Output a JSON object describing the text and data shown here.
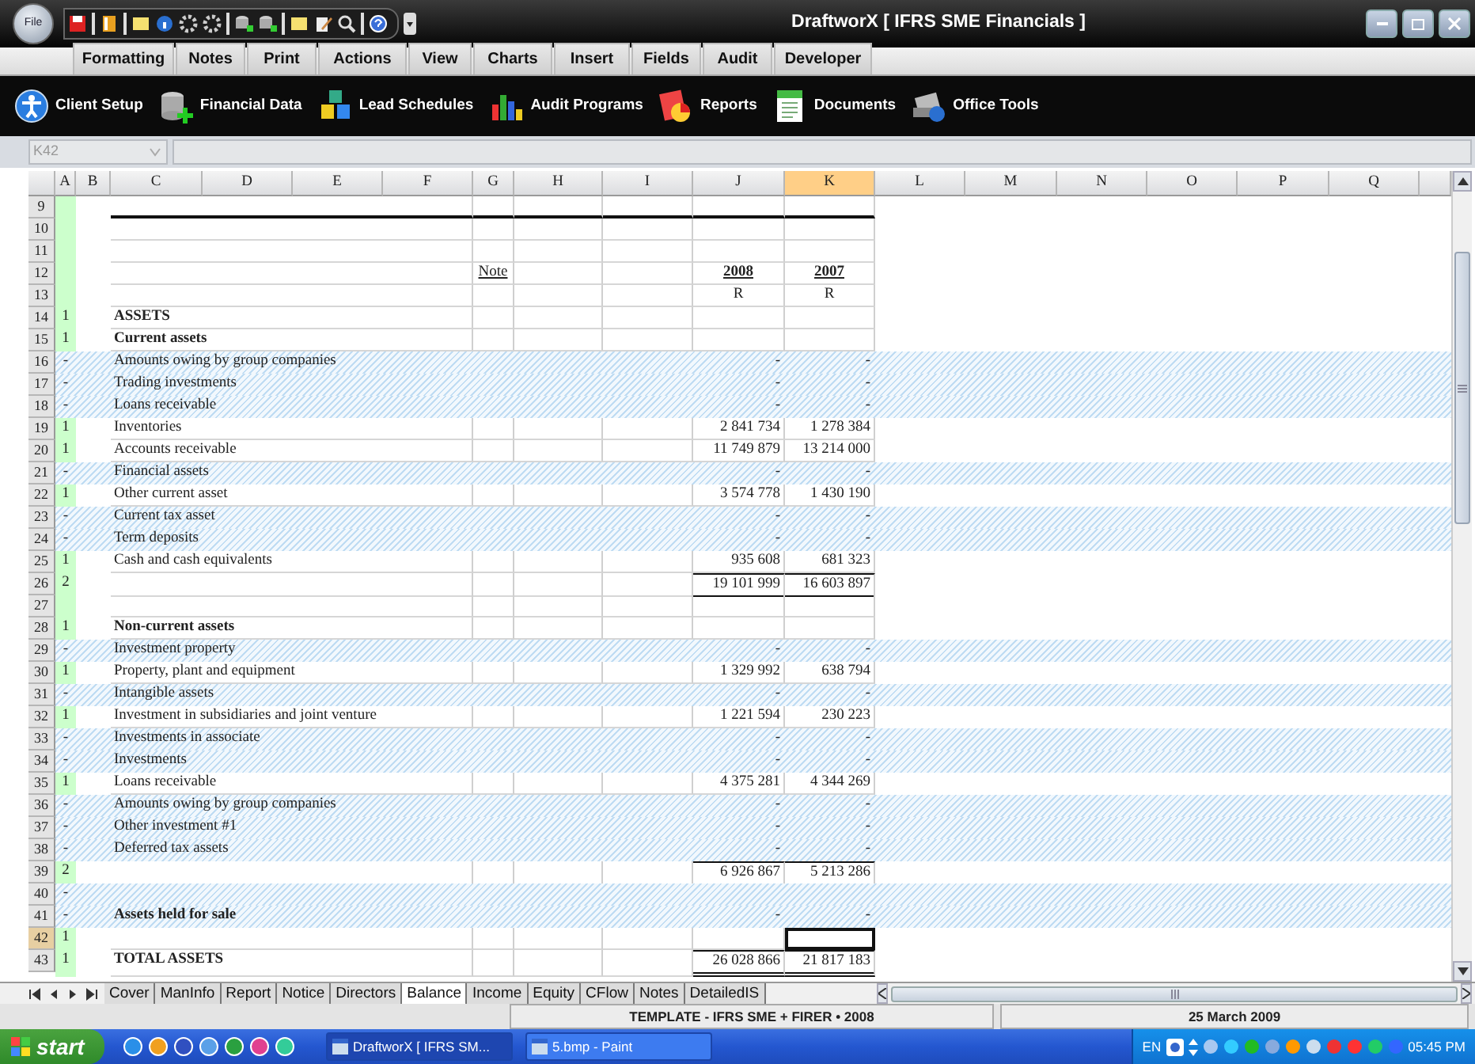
{
  "window": {
    "file_button": "File",
    "title": "DraftworX [ IFRS SME Financials ]"
  },
  "ribbon_tabs": [
    "Formatting",
    "Notes",
    "Print",
    "Actions",
    "View",
    "Charts",
    "Insert",
    "Fields",
    "Audit",
    "Developer"
  ],
  "toolbar": [
    "Client Setup",
    "Financial Data",
    "Lead Schedules",
    "Audit Programs",
    "Reports",
    "Documents",
    "Office Tools"
  ],
  "formula_bar": {
    "name_box": "K42"
  },
  "columns": [
    {
      "label": "A",
      "selected": false
    },
    {
      "label": "B",
      "selected": false
    },
    {
      "label": "C",
      "selected": false
    },
    {
      "label": "D",
      "selected": false
    },
    {
      "label": "E",
      "selected": false
    },
    {
      "label": "F",
      "selected": false
    },
    {
      "label": "G",
      "selected": false
    },
    {
      "label": "H",
      "selected": false
    },
    {
      "label": "I",
      "selected": false
    },
    {
      "label": "J",
      "selected": false
    },
    {
      "label": "K",
      "selected": true
    },
    {
      "label": "L",
      "selected": false
    },
    {
      "label": "M",
      "selected": false
    },
    {
      "label": "N",
      "selected": false
    },
    {
      "label": "O",
      "selected": false
    },
    {
      "label": "P",
      "selected": false
    },
    {
      "label": "Q",
      "selected": false
    }
  ],
  "rows": [
    {
      "num": "9",
      "kind": "line",
      "heading_rule": true,
      "bold": false,
      "hatched": false,
      "selected": false
    },
    {
      "num": "10",
      "kind": "line",
      "bold": false,
      "hatched": false,
      "selected": false
    },
    {
      "num": "11",
      "kind": "line",
      "bold": false,
      "hatched": false,
      "selected": false
    },
    {
      "num": "12",
      "kind": "heading",
      "note": "Note",
      "j": "2008",
      "k": "2007",
      "bold": false,
      "hatched": false,
      "selected": false
    },
    {
      "num": "13",
      "kind": "units",
      "j": "R",
      "k": "R",
      "bold": false,
      "hatched": false,
      "selected": false
    },
    {
      "num": "14",
      "kind": "line",
      "a": "1",
      "label": "ASSETS",
      "bold": true,
      "hatched": false,
      "selected": false
    },
    {
      "num": "15",
      "kind": "line",
      "a": "1",
      "label": "Current assets",
      "bold": true,
      "hatched": false,
      "selected": false
    },
    {
      "num": "16",
      "kind": "line",
      "a": "-",
      "label": "Amounts owing by group companies",
      "j": "-",
      "k": "-",
      "bold": false,
      "hatched": true,
      "selected": false
    },
    {
      "num": "17",
      "kind": "line",
      "a": "-",
      "label": "Trading investments",
      "j": "-",
      "k": "-",
      "bold": false,
      "hatched": true,
      "selected": false
    },
    {
      "num": "18",
      "kind": "line",
      "a": "-",
      "label": "Loans receivable",
      "j": "-",
      "k": "-",
      "bold": false,
      "hatched": true,
      "selected": false
    },
    {
      "num": "19",
      "kind": "line",
      "a": "1",
      "label": "Inventories",
      "j": "2 841 734",
      "k": "1 278 384",
      "bold": false,
      "hatched": false,
      "selected": false
    },
    {
      "num": "20",
      "kind": "line",
      "a": "1",
      "label": "Accounts receivable",
      "j": "11 749 879",
      "k": "13 214 000",
      "bold": false,
      "hatched": false,
      "selected": false
    },
    {
      "num": "21",
      "kind": "line",
      "a": "-",
      "label": "Financial assets",
      "j": "-",
      "k": "-",
      "bold": false,
      "hatched": true,
      "selected": false
    },
    {
      "num": "22",
      "kind": "line",
      "a": "1",
      "label": "Other current asset",
      "j": "3 574 778",
      "k": "1 430 190",
      "bold": false,
      "hatched": false,
      "selected": false
    },
    {
      "num": "23",
      "kind": "line",
      "a": "-",
      "label": "Current tax asset",
      "j": "-",
      "k": "-",
      "bold": false,
      "hatched": true,
      "selected": false
    },
    {
      "num": "24",
      "kind": "line",
      "a": "-",
      "label": "Term deposits",
      "j": "-",
      "k": "-",
      "bold": false,
      "hatched": true,
      "selected": false
    },
    {
      "num": "25",
      "kind": "line",
      "a": "1",
      "label": "Cash and cash equivalents",
      "j": "935 608",
      "k": "681 323",
      "bold": false,
      "hatched": false,
      "selected": false
    },
    {
      "num": "26",
      "kind": "line",
      "a": "2",
      "j": "19 101 999",
      "k": "16 603 897",
      "sum_line": true,
      "bold": false,
      "hatched": false,
      "selected": false
    },
    {
      "num": "27",
      "kind": "line",
      "bold": false,
      "hatched": false,
      "selected": false
    },
    {
      "num": "28",
      "kind": "line",
      "a": "1",
      "label": "Non-current assets",
      "bold": true,
      "hatched": false,
      "selected": false
    },
    {
      "num": "29",
      "kind": "line",
      "a": "-",
      "label": "Investment property",
      "j": "-",
      "k": "-",
      "bold": false,
      "hatched": true,
      "selected": false
    },
    {
      "num": "30",
      "kind": "line",
      "a": "1",
      "label": "Property, plant and equipment",
      "j": "1 329 992",
      "k": "638 794",
      "bold": false,
      "hatched": false,
      "selected": false
    },
    {
      "num": "31",
      "kind": "line",
      "a": "-",
      "label": "Intangible assets",
      "j": "-",
      "k": "-",
      "bold": false,
      "hatched": true,
      "selected": false
    },
    {
      "num": "32",
      "kind": "line",
      "a": "1",
      "label": "Investment in subsidiaries and joint venture",
      "j": "1 221 594",
      "k": "230 223",
      "bold": false,
      "hatched": false,
      "selected": false
    },
    {
      "num": "33",
      "kind": "line",
      "a": "-",
      "label": "Investments in associate",
      "j": "-",
      "k": "-",
      "bold": false,
      "hatched": true,
      "selected": false
    },
    {
      "num": "34",
      "kind": "line",
      "a": "-",
      "label": "Investments",
      "j": "-",
      "k": "-",
      "bold": false,
      "hatched": true,
      "selected": false
    },
    {
      "num": "35",
      "kind": "line",
      "a": "1",
      "label": "Loans receivable",
      "j": "4 375 281",
      "k": "4 344 269",
      "bold": false,
      "hatched": false,
      "selected": false
    },
    {
      "num": "36",
      "kind": "line",
      "a": "-",
      "label": "Amounts owing by group companies",
      "j": "-",
      "k": "-",
      "bold": false,
      "hatched": true,
      "selected": false
    },
    {
      "num": "37",
      "kind": "line",
      "a": "-",
      "label": "Other investment #1",
      "j": "-",
      "k": "-",
      "bold": false,
      "hatched": true,
      "selected": false
    },
    {
      "num": "38",
      "kind": "line",
      "a": "-",
      "label": "Deferred tax assets",
      "j": "-",
      "k": "-",
      "bold": false,
      "hatched": true,
      "selected": false
    },
    {
      "num": "39",
      "kind": "line",
      "a": "2",
      "j": "6 926 867",
      "k": "5 213 286",
      "sum_line": true,
      "bold": false,
      "hatched": false,
      "selected": false
    },
    {
      "num": "40",
      "kind": "line",
      "a": "-",
      "bold": false,
      "hatched": true,
      "selected": false
    },
    {
      "num": "41",
      "kind": "line",
      "a": "-",
      "label": "Assets held for sale",
      "j": "-",
      "k": "-",
      "bold": true,
      "hatched": true,
      "selected": false
    },
    {
      "num": "42",
      "kind": "line",
      "a": "1",
      "bold": false,
      "hatched": false,
      "selected": true
    },
    {
      "num": "43",
      "kind": "line",
      "a": "1",
      "label": "TOTAL ASSETS",
      "j": "26 028 866",
      "k": "21 817 183",
      "total_line": true,
      "bold": true,
      "hatched": false,
      "selected": false
    }
  ],
  "sheet_tabs": [
    {
      "label": "Cover",
      "selected": false
    },
    {
      "label": "ManInfo",
      "selected": false
    },
    {
      "label": "Report",
      "selected": false
    },
    {
      "label": "Notice",
      "selected": false
    },
    {
      "label": "Directors",
      "selected": false
    },
    {
      "label": "Balance",
      "selected": true
    },
    {
      "label": "Income",
      "selected": false
    },
    {
      "label": "Equity",
      "selected": false
    },
    {
      "label": "CFlow",
      "selected": false
    },
    {
      "label": "Notes",
      "selected": false
    },
    {
      "label": "DetailedIS",
      "selected": false
    }
  ],
  "status_bar": {
    "template": "TEMPLATE - IFRS SME + FIRER  •  2008",
    "date": "25 March 2009"
  },
  "taskbar": {
    "start": "start",
    "tasks": [
      "DraftworX  [ IFRS SM...",
      "5.bmp - Paint"
    ],
    "language": "EN",
    "time": "05:45 PM"
  }
}
